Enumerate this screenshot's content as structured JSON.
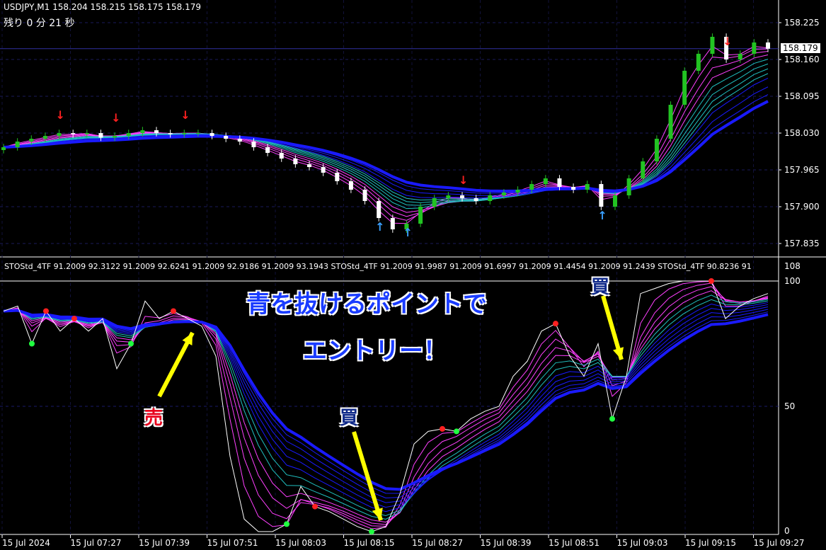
{
  "header": {
    "symbol_line": "USDJPY,M1  158.204 158.215 158.175 158.179",
    "countdown": "残り 0 分 21 秒"
  },
  "indicator_label": "STOStd_4TF 91.2009 92.3122 91.2009 92.6241 91.2009 92.9186 91.2009 93.1943  STOStd_4TF 91.2009 91.9987 91.2009 91.6997 91.2009 91.4454 91.2009 91.2439  STOStd_4TF 90.8236 91",
  "annotations": {
    "line1": "青を抜けるポイントで",
    "line2": "エントリー！",
    "sell": "売",
    "buy1": "買",
    "buy2": "買"
  },
  "current_price": "158.179",
  "colors": {
    "bull": "#22c322",
    "bear": "#ffffff",
    "ribbon_slow": "#1a1aff",
    "ribbon_fast": "#ff40ff",
    "ribbon_mid": "#20c0c0",
    "sell_arrow": "#ff2020",
    "buy_arrow": "#3aa0ff",
    "annotation_arrow": "#ffff00"
  },
  "chart_data": [
    {
      "type": "candlestick",
      "title": "USDJPY,M1",
      "y_ticks": [
        "158.225",
        "158.160",
        "158.095",
        "158.030",
        "157.965",
        "157.900",
        "157.835"
      ],
      "ylim": [
        157.82,
        158.25
      ],
      "x_ticks": [
        "15 Jul 2024",
        "15 Jul 07:27",
        "15 Jul 07:39",
        "15 Jul 07:51",
        "15 Jul 08:03",
        "15 Jul 08:15",
        "15 Jul 08:27",
        "15 Jul 08:39",
        "15 Jul 08:51",
        "15 Jul 09:03",
        "15 Jul 09:15",
        "15 Jul 09:27"
      ],
      "grid": true,
      "closes": [
        158.005,
        158.015,
        158.02,
        158.025,
        158.03,
        158.028,
        158.03,
        158.022,
        158.025,
        158.03,
        158.035,
        158.03,
        158.028,
        158.03,
        158.03,
        158.025,
        158.02,
        158.015,
        158.005,
        157.995,
        157.985,
        157.975,
        157.97,
        157.96,
        157.945,
        157.93,
        157.91,
        157.88,
        157.86,
        157.87,
        157.9,
        157.915,
        157.92,
        157.915,
        157.91,
        157.92,
        157.925,
        157.93,
        157.94,
        157.95,
        157.935,
        157.93,
        157.94,
        157.9,
        157.92,
        157.95,
        157.98,
        158.02,
        158.08,
        158.14,
        158.17,
        158.2,
        158.16,
        158.17,
        158.19,
        158.179
      ]
    },
    {
      "type": "line",
      "title": "STOStd_4TF",
      "y_ticks": [
        "108",
        "100",
        "50",
        "0"
      ],
      "ylim": [
        0,
        108
      ],
      "values": [
        88,
        90,
        75,
        88,
        80,
        85,
        80,
        85,
        65,
        75,
        92,
        85,
        88,
        85,
        82,
        70,
        30,
        5,
        0,
        0,
        3,
        18,
        10,
        8,
        5,
        2,
        0,
        2,
        15,
        35,
        40,
        41,
        40,
        45,
        48,
        50,
        62,
        68,
        80,
        83,
        70,
        62,
        75,
        45,
        62,
        95,
        97,
        99,
        100,
        100,
        100,
        85,
        90,
        93,
        95
      ]
    }
  ]
}
